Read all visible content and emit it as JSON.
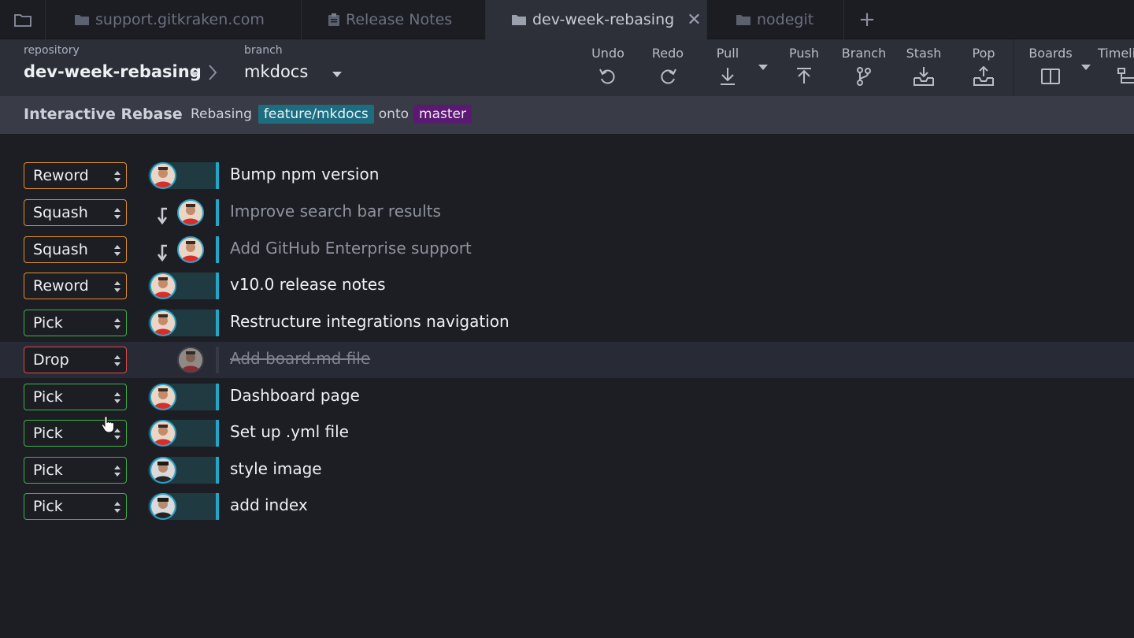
{
  "tabs": [
    {
      "label": "support.gitkraken.com",
      "icon": "folder-icon",
      "active": false
    },
    {
      "label": "Release Notes",
      "icon": "clipboard-icon",
      "active": false
    },
    {
      "label": "dev-week-rebasing",
      "icon": "folder-icon",
      "active": true
    },
    {
      "label": "nodegit",
      "icon": "folder-icon",
      "active": false
    }
  ],
  "tabbar": {
    "close_glyph": "✕",
    "add_glyph": "+"
  },
  "toolbar": {
    "repository_caption": "repository",
    "repository_name": "dev-week-rebasing",
    "branch_caption": "branch",
    "branch_name": "mkdocs",
    "actions": [
      {
        "label": "Undo",
        "icon": "undo-icon"
      },
      {
        "label": "Redo",
        "icon": "redo-icon"
      },
      {
        "label": "Pull",
        "icon": "pull-icon"
      },
      {
        "label": "Push",
        "icon": "push-icon"
      },
      {
        "label": "Branch",
        "icon": "branch-icon"
      },
      {
        "label": "Stash",
        "icon": "stash-icon"
      },
      {
        "label": "Pop",
        "icon": "pop-icon"
      },
      {
        "label": "Boards",
        "icon": "boards-icon"
      },
      {
        "label": "Timeli",
        "icon": "timeline-icon"
      }
    ]
  },
  "rebase": {
    "title": "Interactive Rebase",
    "rebasing_text": "Rebasing",
    "source_branch": "feature/mkdocs",
    "onto_text": "onto",
    "target_branch": "master"
  },
  "commits": [
    {
      "action": "Reword",
      "message": "Bump npm version"
    },
    {
      "action": "Squash",
      "message": "Improve search bar results"
    },
    {
      "action": "Squash",
      "message": "Add GitHub Enterprise support"
    },
    {
      "action": "Reword",
      "message": "v10.0 release notes"
    },
    {
      "action": "Pick",
      "message": "Restructure integrations navigation"
    },
    {
      "action": "Drop",
      "message": "Add board.md file"
    },
    {
      "action": "Pick",
      "message": "Dashboard page"
    },
    {
      "action": "Pick",
      "message": "Set up .yml file"
    },
    {
      "action": "Pick",
      "message": "style image"
    },
    {
      "action": "Pick",
      "message": "add index"
    }
  ],
  "colors": {
    "reword": "#e0902f",
    "squash": "#e0902f",
    "pick": "#3fb14a",
    "drop": "#de4a4a",
    "lane": "#22a6c8",
    "feature_pill": "#1d6d80",
    "master_pill": "#5b1a72"
  }
}
